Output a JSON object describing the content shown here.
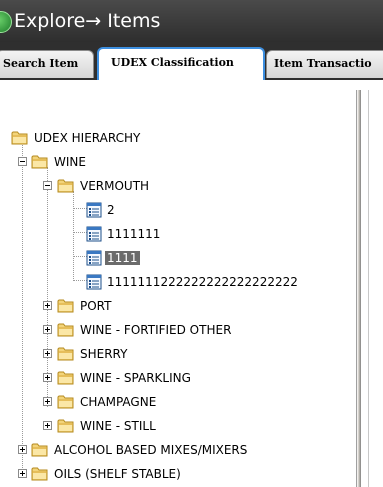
{
  "window": {
    "title": "Explore→ Items"
  },
  "tabs": [
    {
      "label": "Search Item",
      "active": false
    },
    {
      "label": "UDEX Classification",
      "active": true
    },
    {
      "label": "Item Transactio",
      "active": false
    }
  ],
  "tree": {
    "root": "UDEX HIERARCHY",
    "wine": "WINE",
    "vermouth": "VERMOUTH",
    "items": [
      "2",
      "1111111",
      "1111",
      "1111111222222222222222222"
    ],
    "selected_item": "1111",
    "wine_children": [
      "PORT",
      "WINE - FORTIFIED OTHER",
      "SHERRY",
      "WINE - SPARKLING",
      "CHAMPAGNE",
      "WINE - STILL"
    ],
    "root_children": [
      "ALCOHOL BASED MIXES/MIXERS",
      "OILS (SHELF STABLE)"
    ]
  },
  "colors": {
    "title_bar": "#3a3a3a",
    "tab_strip": "#2f2f2f",
    "active_tab_border": "#3d8fe0",
    "selection_bg": "#6b6b6b",
    "folder": "#e8c35a"
  }
}
